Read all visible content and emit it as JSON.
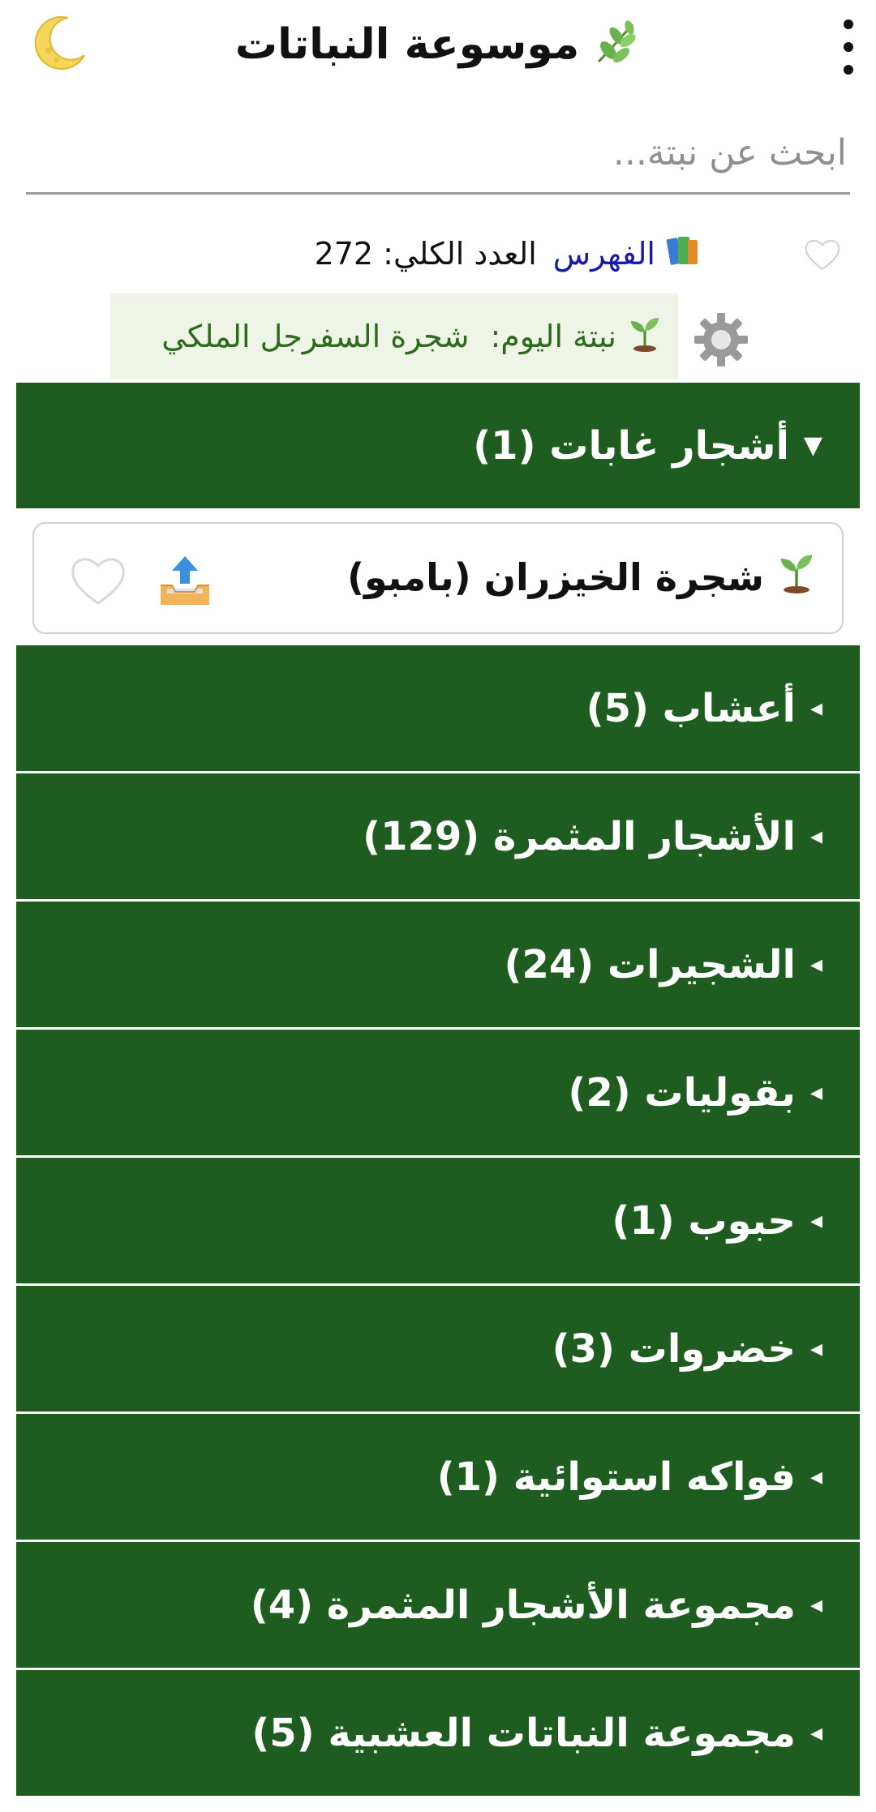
{
  "header": {
    "title": "موسوعة النباتات",
    "title_icon": "herb-icon",
    "theme_icon": "crescent-moon-icon",
    "menu_icon": "vertical-dots-icon"
  },
  "search": {
    "placeholder": "ابحث عن نبتة..."
  },
  "index": {
    "link_label": "الفهرس",
    "total_text": "العدد الكلي: 272"
  },
  "plant_of_day": {
    "label": "نبتة اليوم:",
    "name": "شجرة السفرجل الملكي"
  },
  "categories": [
    {
      "label": "أشجار غابات (1)",
      "arrow": "▼"
    },
    {
      "label": "أعشاب (5)",
      "arrow": "◂"
    },
    {
      "label": "الأشجار المثمرة (129)",
      "arrow": "◂"
    },
    {
      "label": "الشجيرات (24)",
      "arrow": "◂"
    },
    {
      "label": "بقوليات (2)",
      "arrow": "◂"
    },
    {
      "label": "حبوب (1)",
      "arrow": "◂"
    },
    {
      "label": "خضروات (3)",
      "arrow": "◂"
    },
    {
      "label": "فواكه استوائية (1)",
      "arrow": "◂"
    },
    {
      "label": "مجموعة الأشجار المثمرة (4)",
      "arrow": "◂"
    },
    {
      "label": "مجموعة النباتات العشبية (5)",
      "arrow": "◂"
    }
  ],
  "expanded_items": [
    {
      "name": "شجرة الخيزران (بامبو)"
    }
  ],
  "colors": {
    "category_bg": "#1e5c20",
    "potd_bg": "#eef5e6",
    "potd_text": "#2d6a1c",
    "link": "#1a1aa8"
  }
}
